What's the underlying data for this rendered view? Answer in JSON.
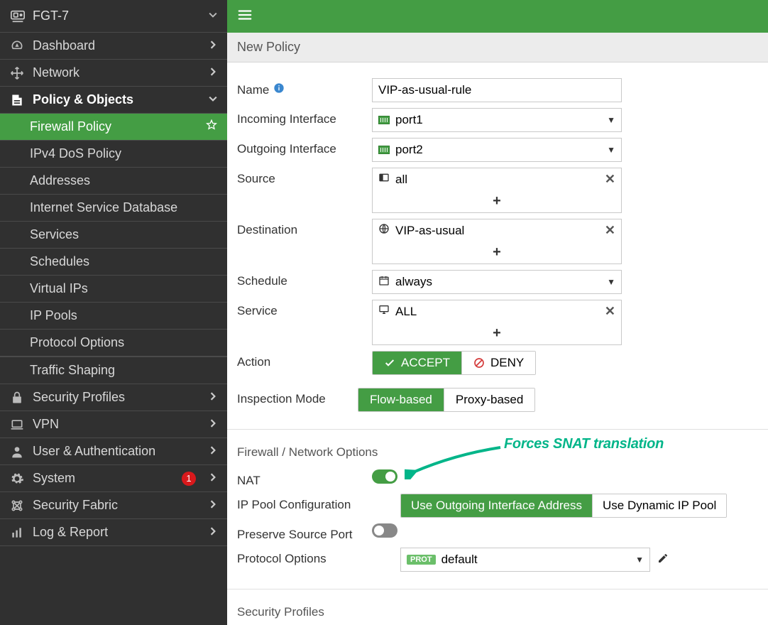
{
  "header": {
    "device": "FGT-7"
  },
  "sidebar": [
    {
      "id": "dashboard",
      "label": "Dashboard",
      "icon": "gauge",
      "chev": "right"
    },
    {
      "id": "network",
      "label": "Network",
      "icon": "move",
      "chev": "right"
    },
    {
      "id": "policy",
      "label": "Policy & Objects",
      "icon": "policy",
      "chev": "down",
      "expanded": true,
      "children": [
        {
          "id": "fwpolicy",
          "label": "Firewall Policy",
          "active": true,
          "star": true
        },
        {
          "id": "dospolicy",
          "label": "IPv4 DoS Policy"
        },
        {
          "id": "addresses",
          "label": "Addresses"
        },
        {
          "id": "isdb",
          "label": "Internet Service Database"
        },
        {
          "id": "services",
          "label": "Services"
        },
        {
          "id": "schedules",
          "label": "Schedules"
        },
        {
          "id": "vips",
          "label": "Virtual IPs"
        },
        {
          "id": "ippools",
          "label": "IP Pools"
        },
        {
          "id": "protopts",
          "label": "Protocol Options"
        },
        {
          "id": "traffic",
          "label": "Traffic Shaping",
          "divider_before": true
        }
      ]
    },
    {
      "id": "secprof",
      "label": "Security Profiles",
      "icon": "lock",
      "chev": "right"
    },
    {
      "id": "vpn",
      "label": "VPN",
      "icon": "laptop",
      "chev": "right"
    },
    {
      "id": "userauth",
      "label": "User & Authentication",
      "icon": "user",
      "chev": "right"
    },
    {
      "id": "system",
      "label": "System",
      "icon": "gear",
      "chev": "right",
      "badge": "1"
    },
    {
      "id": "fabric",
      "label": "Security Fabric",
      "icon": "fabric",
      "chev": "right"
    },
    {
      "id": "log",
      "label": "Log & Report",
      "icon": "chart",
      "chev": "right"
    }
  ],
  "page": {
    "breadcrumb": "New Policy",
    "fields": {
      "name_label": "Name",
      "name_value": "VIP-as-usual-rule",
      "incoming_label": "Incoming Interface",
      "incoming_value": "port1",
      "outgoing_label": "Outgoing Interface",
      "outgoing_value": "port2",
      "source_label": "Source",
      "source_value": "all",
      "destination_label": "Destination",
      "destination_value": "VIP-as-usual",
      "schedule_label": "Schedule",
      "schedule_value": "always",
      "service_label": "Service",
      "service_value": "ALL",
      "action_label": "Action",
      "accept": "ACCEPT",
      "deny": "DENY",
      "inspection_label": "Inspection Mode",
      "flow": "Flow-based",
      "proxy": "Proxy-based",
      "section_fw": "Firewall / Network Options",
      "nat_label": "NAT",
      "ippool_label": "IP Pool Configuration",
      "ippool_a": "Use Outgoing Interface Address",
      "ippool_b": "Use Dynamic IP Pool",
      "preserve_label": "Preserve Source Port",
      "protopts_label": "Protocol Options",
      "protopts_badge": "PROT",
      "protopts_value": "default",
      "section_sec": "Security Profiles",
      "plus": "+"
    }
  },
  "annotation": "Forces SNAT translation"
}
